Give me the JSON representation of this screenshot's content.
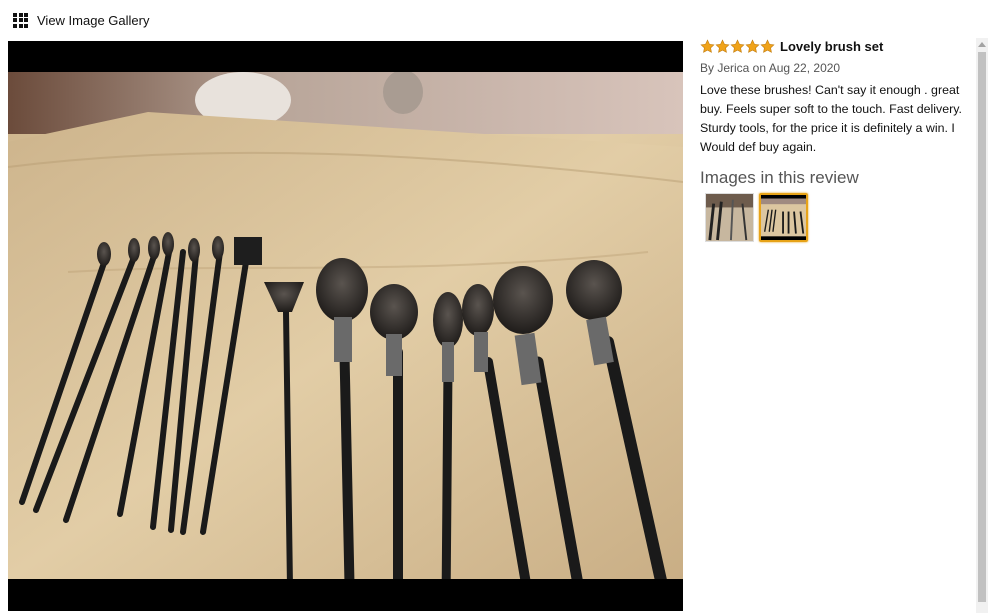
{
  "gallery": {
    "icon": "grid-icon",
    "label": "View Image Gallery"
  },
  "review": {
    "rating": 5,
    "rating_max": 5,
    "star_color": "#f0a31a",
    "title": "Lovely brush set",
    "byline": "By Jerica on Aug 22, 2020",
    "body": "Love these brushes! Can't say it enough . great buy. Feels super soft to the touch. Fast delivery. Sturdy tools, for the price it is definitely a win. I Would def buy again.",
    "images_heading": "Images in this review",
    "thumbnails": [
      {
        "selected": false
      },
      {
        "selected": true
      }
    ]
  },
  "colors": {
    "selected_border": "#e7a318",
    "viewer_background": "#000000"
  }
}
